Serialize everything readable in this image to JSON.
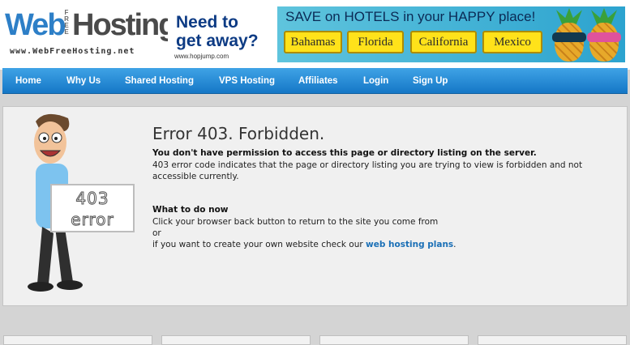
{
  "logo": {
    "web": "Web",
    "free": "FREE",
    "hosting": "Hosting",
    "url": "www.WebFreeHosting.net"
  },
  "ad": {
    "headline": "Need to get away?",
    "source": "www.hopjump.com",
    "promo": "SAVE on HOTELS in your HAPPY place!",
    "destinations": [
      "Bahamas",
      "Florida",
      "California",
      "Mexico"
    ],
    "colors": {
      "sky": "#2ca3cf",
      "button": "#ffe21a",
      "headline": "#0d3b84"
    }
  },
  "nav": {
    "items": [
      "Home",
      "Why Us",
      "Shared Hosting",
      "VPS Hosting",
      "Affiliates",
      "Login",
      "Sign Up"
    ],
    "color": "#1a86d8"
  },
  "error": {
    "sign_line1": "403",
    "sign_line2": "error",
    "title": "Error 403. Forbidden.",
    "lead": "You don't have permission to access this page or directory listing on the server.",
    "explanation": "403 error code indicates that the page or directory listing you are trying to view is forbidden and not accessible currently.",
    "todo_heading": "What to do now",
    "todo_line1": "Click your browser back button to return to the site you come from",
    "todo_or": "or",
    "todo_line2_prefix": "if you want to create your own website check our",
    "todo_link": "web hosting plans",
    "todo_line2_suffix": "."
  }
}
